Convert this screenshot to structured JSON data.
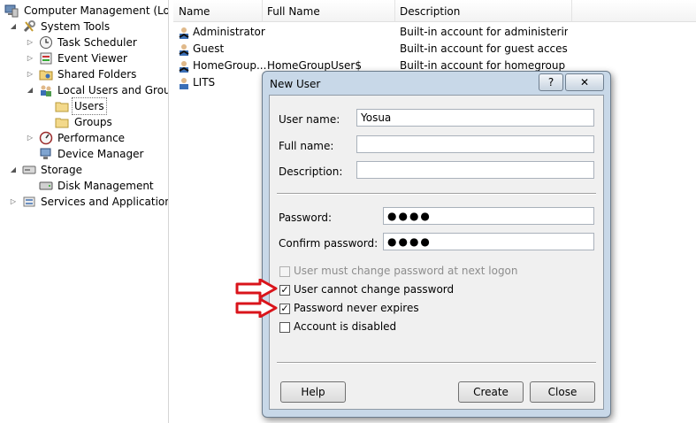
{
  "tree": {
    "items": [
      {
        "label": "Computer Management (Local",
        "icon": "computer-management-icon"
      },
      {
        "label": "System Tools",
        "icon": "system-tools-icon"
      },
      {
        "label": "Task Scheduler",
        "icon": "clock-icon"
      },
      {
        "label": "Event Viewer",
        "icon": "event-viewer-icon"
      },
      {
        "label": "Shared Folders",
        "icon": "shared-folder-icon"
      },
      {
        "label": "Local Users and Groups",
        "icon": "users-group-icon"
      },
      {
        "label": "Users",
        "icon": "folder-icon"
      },
      {
        "label": "Groups",
        "icon": "folder-icon"
      },
      {
        "label": "Performance",
        "icon": "performance-icon"
      },
      {
        "label": "Device Manager",
        "icon": "device-manager-icon"
      },
      {
        "label": "Storage",
        "icon": "storage-icon"
      },
      {
        "label": "Disk Management",
        "icon": "disk-icon"
      },
      {
        "label": "Services and Applications",
        "icon": "services-icon"
      }
    ]
  },
  "list": {
    "columns": [
      "Name",
      "Full Name",
      "Description"
    ],
    "rows": [
      {
        "name": "Administrator",
        "full_name": "",
        "description": "Built-in account for administering..."
      },
      {
        "name": "Guest",
        "full_name": "",
        "description": "Built-in account for guest access t..."
      },
      {
        "name": "HomeGroup...",
        "full_name": "HomeGroupUser$",
        "description": "Built-in account for homegroup a..."
      },
      {
        "name": "LITS",
        "full_name": "",
        "description": ""
      }
    ]
  },
  "dialog": {
    "title": "New User",
    "help_glyph": "?",
    "close_glyph": "✕",
    "username_label": "User name:",
    "username_value": "Yosua",
    "fullname_label": "Full name:",
    "fullname_value": "",
    "description_label": "Description:",
    "description_value": "",
    "password_label": "Password:",
    "password_value": "●●●●",
    "confirm_label": "Confirm password:",
    "confirm_value": "●●●●",
    "checkboxes": [
      {
        "label": "User must change password at next logon",
        "checked": false,
        "disabled": true
      },
      {
        "label": "User cannot change password",
        "checked": true,
        "disabled": false
      },
      {
        "label": "Password never expires",
        "checked": true,
        "disabled": false
      },
      {
        "label": "Account is disabled",
        "checked": false,
        "disabled": false
      }
    ],
    "check_glyph": "✓",
    "help_button": "Help",
    "create_button": "Create",
    "close_button": "Close"
  },
  "colors": {
    "annotation_arrow": "#d9141b",
    "dialog_frame": "#c8d8e8"
  }
}
